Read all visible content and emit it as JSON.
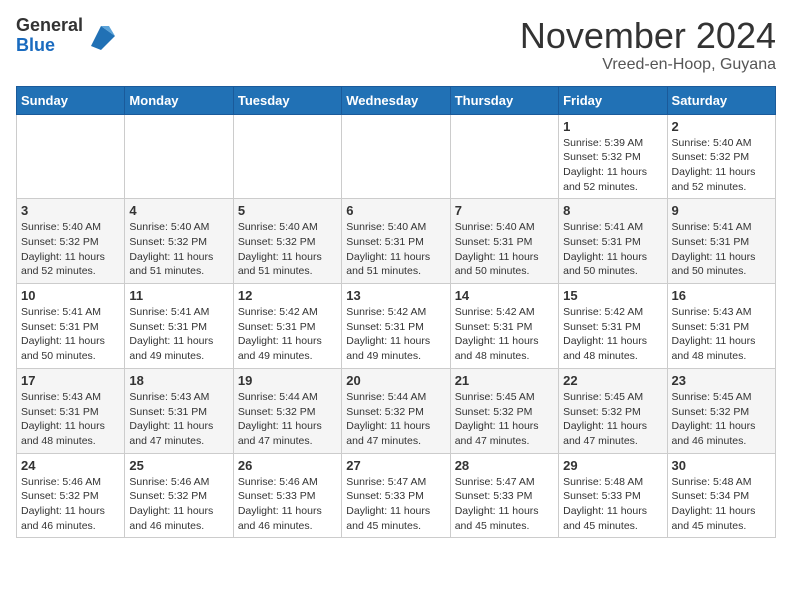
{
  "header": {
    "logo_line1": "General",
    "logo_line2": "Blue",
    "month": "November 2024",
    "location": "Vreed-en-Hoop, Guyana"
  },
  "days_of_week": [
    "Sunday",
    "Monday",
    "Tuesday",
    "Wednesday",
    "Thursday",
    "Friday",
    "Saturday"
  ],
  "weeks": [
    [
      {
        "day": "",
        "info": ""
      },
      {
        "day": "",
        "info": ""
      },
      {
        "day": "",
        "info": ""
      },
      {
        "day": "",
        "info": ""
      },
      {
        "day": "",
        "info": ""
      },
      {
        "day": "1",
        "info": "Sunrise: 5:39 AM\nSunset: 5:32 PM\nDaylight: 11 hours\nand 52 minutes."
      },
      {
        "day": "2",
        "info": "Sunrise: 5:40 AM\nSunset: 5:32 PM\nDaylight: 11 hours\nand 52 minutes."
      }
    ],
    [
      {
        "day": "3",
        "info": "Sunrise: 5:40 AM\nSunset: 5:32 PM\nDaylight: 11 hours\nand 52 minutes."
      },
      {
        "day": "4",
        "info": "Sunrise: 5:40 AM\nSunset: 5:32 PM\nDaylight: 11 hours\nand 51 minutes."
      },
      {
        "day": "5",
        "info": "Sunrise: 5:40 AM\nSunset: 5:32 PM\nDaylight: 11 hours\nand 51 minutes."
      },
      {
        "day": "6",
        "info": "Sunrise: 5:40 AM\nSunset: 5:31 PM\nDaylight: 11 hours\nand 51 minutes."
      },
      {
        "day": "7",
        "info": "Sunrise: 5:40 AM\nSunset: 5:31 PM\nDaylight: 11 hours\nand 50 minutes."
      },
      {
        "day": "8",
        "info": "Sunrise: 5:41 AM\nSunset: 5:31 PM\nDaylight: 11 hours\nand 50 minutes."
      },
      {
        "day": "9",
        "info": "Sunrise: 5:41 AM\nSunset: 5:31 PM\nDaylight: 11 hours\nand 50 minutes."
      }
    ],
    [
      {
        "day": "10",
        "info": "Sunrise: 5:41 AM\nSunset: 5:31 PM\nDaylight: 11 hours\nand 50 minutes."
      },
      {
        "day": "11",
        "info": "Sunrise: 5:41 AM\nSunset: 5:31 PM\nDaylight: 11 hours\nand 49 minutes."
      },
      {
        "day": "12",
        "info": "Sunrise: 5:42 AM\nSunset: 5:31 PM\nDaylight: 11 hours\nand 49 minutes."
      },
      {
        "day": "13",
        "info": "Sunrise: 5:42 AM\nSunset: 5:31 PM\nDaylight: 11 hours\nand 49 minutes."
      },
      {
        "day": "14",
        "info": "Sunrise: 5:42 AM\nSunset: 5:31 PM\nDaylight: 11 hours\nand 48 minutes."
      },
      {
        "day": "15",
        "info": "Sunrise: 5:42 AM\nSunset: 5:31 PM\nDaylight: 11 hours\nand 48 minutes."
      },
      {
        "day": "16",
        "info": "Sunrise: 5:43 AM\nSunset: 5:31 PM\nDaylight: 11 hours\nand 48 minutes."
      }
    ],
    [
      {
        "day": "17",
        "info": "Sunrise: 5:43 AM\nSunset: 5:31 PM\nDaylight: 11 hours\nand 48 minutes."
      },
      {
        "day": "18",
        "info": "Sunrise: 5:43 AM\nSunset: 5:31 PM\nDaylight: 11 hours\nand 47 minutes."
      },
      {
        "day": "19",
        "info": "Sunrise: 5:44 AM\nSunset: 5:32 PM\nDaylight: 11 hours\nand 47 minutes."
      },
      {
        "day": "20",
        "info": "Sunrise: 5:44 AM\nSunset: 5:32 PM\nDaylight: 11 hours\nand 47 minutes."
      },
      {
        "day": "21",
        "info": "Sunrise: 5:45 AM\nSunset: 5:32 PM\nDaylight: 11 hours\nand 47 minutes."
      },
      {
        "day": "22",
        "info": "Sunrise: 5:45 AM\nSunset: 5:32 PM\nDaylight: 11 hours\nand 47 minutes."
      },
      {
        "day": "23",
        "info": "Sunrise: 5:45 AM\nSunset: 5:32 PM\nDaylight: 11 hours\nand 46 minutes."
      }
    ],
    [
      {
        "day": "24",
        "info": "Sunrise: 5:46 AM\nSunset: 5:32 PM\nDaylight: 11 hours\nand 46 minutes."
      },
      {
        "day": "25",
        "info": "Sunrise: 5:46 AM\nSunset: 5:32 PM\nDaylight: 11 hours\nand 46 minutes."
      },
      {
        "day": "26",
        "info": "Sunrise: 5:46 AM\nSunset: 5:33 PM\nDaylight: 11 hours\nand 46 minutes."
      },
      {
        "day": "27",
        "info": "Sunrise: 5:47 AM\nSunset: 5:33 PM\nDaylight: 11 hours\nand 45 minutes."
      },
      {
        "day": "28",
        "info": "Sunrise: 5:47 AM\nSunset: 5:33 PM\nDaylight: 11 hours\nand 45 minutes."
      },
      {
        "day": "29",
        "info": "Sunrise: 5:48 AM\nSunset: 5:33 PM\nDaylight: 11 hours\nand 45 minutes."
      },
      {
        "day": "30",
        "info": "Sunrise: 5:48 AM\nSunset: 5:34 PM\nDaylight: 11 hours\nand 45 minutes."
      }
    ]
  ]
}
